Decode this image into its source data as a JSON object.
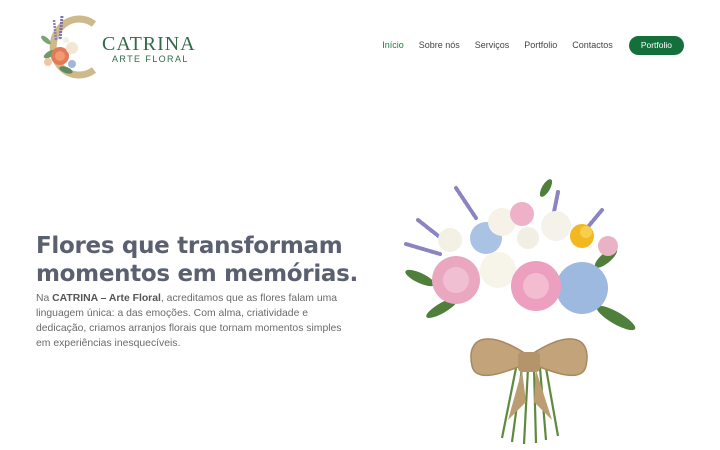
{
  "header": {
    "logo": {
      "name": "CATRINA",
      "subtitle": "ARTE FLORAL",
      "icon": "floral-monogram-c"
    },
    "nav": [
      {
        "label": "Início",
        "active": true
      },
      {
        "label": "Sobre nós",
        "active": false
      },
      {
        "label": "Serviços",
        "active": false
      },
      {
        "label": "Portfolio",
        "active": false
      },
      {
        "label": "Contactos",
        "active": false
      }
    ],
    "cta_label": "Portfolio"
  },
  "hero": {
    "title": "Flores que transformam momentos em memórias.",
    "text_prefix": "Na ",
    "brand": "CATRINA – Arte Floral",
    "text_suffix": ", acreditamos que as flores falam uma linguagem única: a das emoções. Com alma, criatividade e dedicação, criamos arranjos florais que tornam momentos simples em experiências inesquecíveis.",
    "image": "flower-bouquet-with-burlap-bow"
  },
  "colors": {
    "brand_green": "#14703a",
    "active_nav": "#1e7a3e",
    "title_gray": "#5a6070",
    "text_gray": "#6a6a6a"
  }
}
